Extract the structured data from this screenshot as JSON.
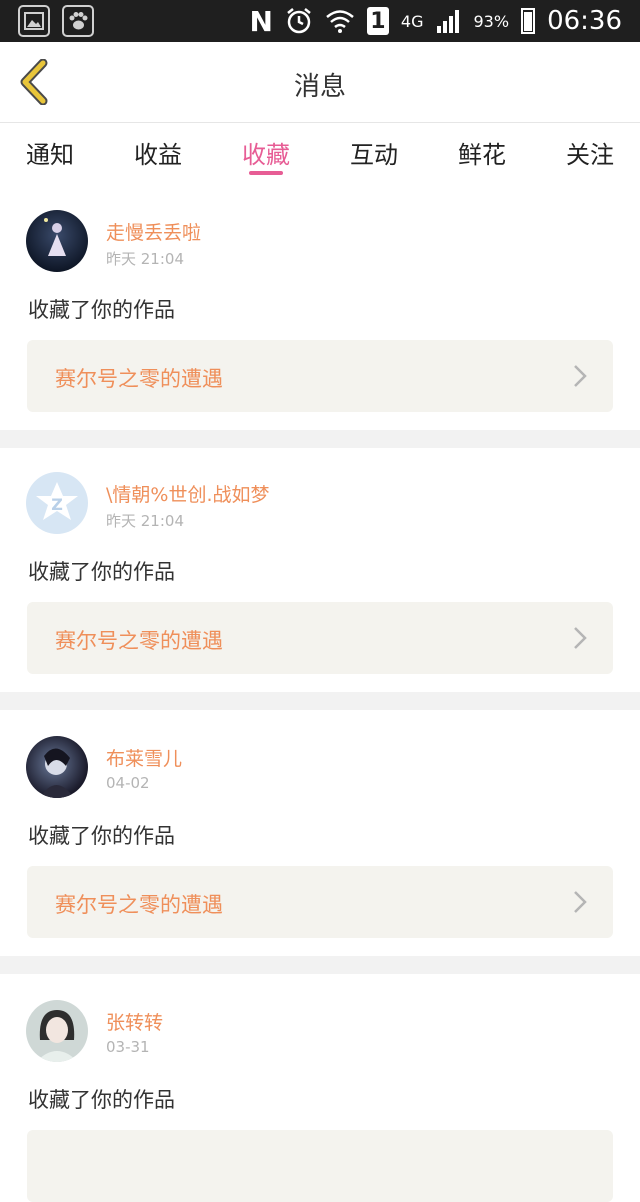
{
  "status_bar": {
    "network": "4G",
    "sim": "1",
    "battery": "93%",
    "time": "06:36",
    "icons": [
      "gallery-icon",
      "paw-app-icon",
      "nfc-icon",
      "alarm-icon",
      "wifi-icon",
      "signal-icon",
      "battery-icon"
    ]
  },
  "header": {
    "title": "消息",
    "back_icon": "chevron-left-icon",
    "accent": "#e8c53a"
  },
  "tabs": [
    {
      "label": "通知",
      "active": false
    },
    {
      "label": "收益",
      "active": false
    },
    {
      "label": "收藏",
      "active": true
    },
    {
      "label": "互动",
      "active": false
    },
    {
      "label": "鲜花",
      "active": false
    },
    {
      "label": "关注",
      "active": false
    }
  ],
  "colors": {
    "active_tab": "#e75d95",
    "username": "#ef8f5a",
    "work_bg": "#f4f3ee"
  },
  "messages": [
    {
      "username": "走慢丢丢啦",
      "time": "昨天 21:04",
      "action": "收藏了你的作品",
      "work_title": "赛尔号之零的遭遇"
    },
    {
      "username": "\\情朝%世创.战如梦",
      "time": "昨天 21:04",
      "action": "收藏了你的作品",
      "work_title": "赛尔号之零的遭遇"
    },
    {
      "username": "布莱雪儿",
      "time": "04-02",
      "action": "收藏了你的作品",
      "work_title": "赛尔号之零的遭遇"
    },
    {
      "username": "张转转",
      "time": "03-31",
      "action": "收藏了你的作品",
      "work_title": ""
    }
  ]
}
